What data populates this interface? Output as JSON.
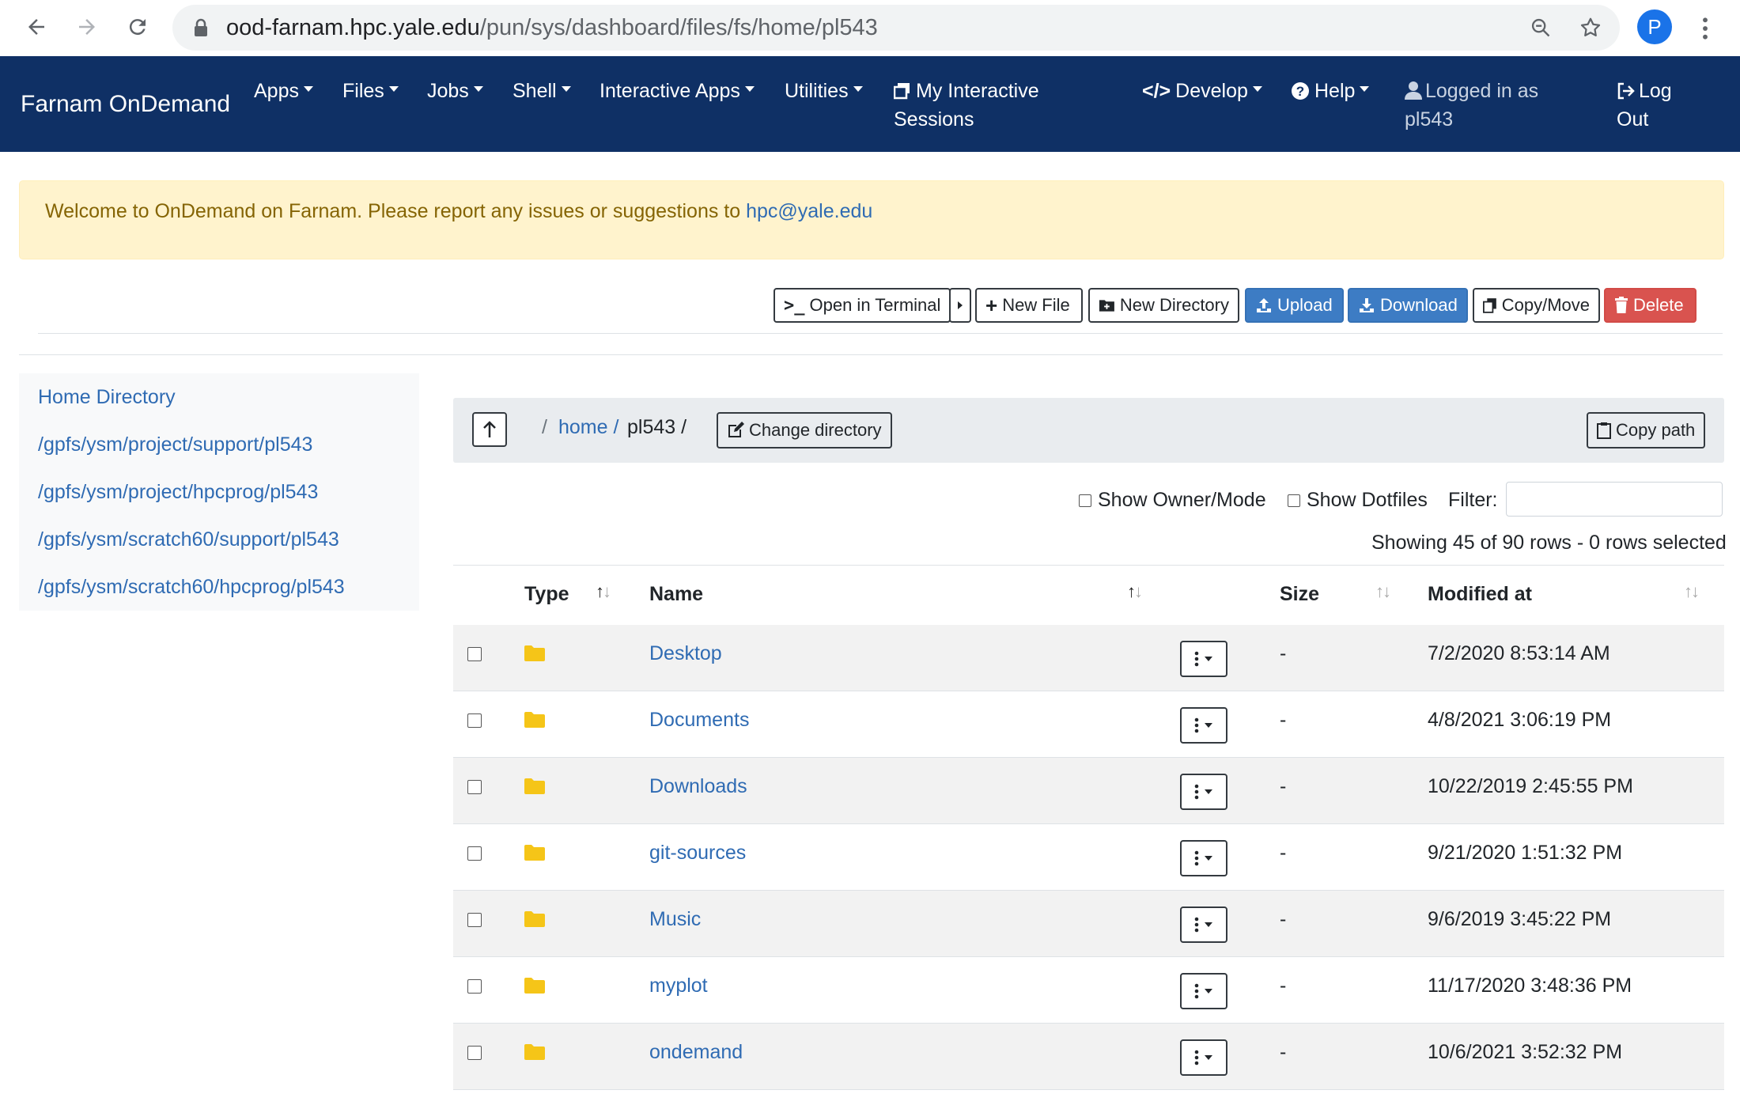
{
  "browser": {
    "url_host": "ood-farnam.hpc.yale.edu",
    "url_path": "/pun/sys/dashboard/files/fs/home/pl543",
    "profile_initial": "P"
  },
  "navbar": {
    "brand": "Farnam OnDemand",
    "items": {
      "apps": "Apps",
      "files": "Files",
      "jobs": "Jobs",
      "shell": "Shell",
      "interactive_apps": "Interactive Apps",
      "utilities": "Utilities",
      "sessions_line1": "My Interactive",
      "sessions_line2": "Sessions",
      "develop": "Develop",
      "help": "Help",
      "logged_in_line1": "Logged in as",
      "logged_in_line2": "pl543",
      "logout_line1": "Log",
      "logout_line2": "Out"
    }
  },
  "alert": {
    "text": "Welcome to OnDemand on Farnam. Please report any issues or suggestions to ",
    "email": "hpc@yale.edu"
  },
  "toolbar": {
    "open_terminal": "Open in Terminal",
    "new_file": "New File",
    "new_directory": "New Directory",
    "upload": "Upload",
    "download": "Download",
    "copy_move": "Copy/Move",
    "delete": "Delete"
  },
  "favorites": [
    "Home Directory",
    "/gpfs/ysm/project/support/pl543",
    "/gpfs/ysm/project/hpcprog/pl543",
    "/gpfs/ysm/scratch60/support/pl543",
    "/gpfs/ysm/scratch60/hpcprog/pl543"
  ],
  "pathbar": {
    "crumb_root": "/",
    "crumb_home": "home /",
    "crumb_current": "pl543 /",
    "change_directory": "Change directory",
    "copy_path": "Copy path"
  },
  "options": {
    "show_owner_mode": "Show Owner/Mode",
    "show_dotfiles": "Show Dotfiles",
    "filter_label": "Filter:",
    "showing": "Showing 45 of 90 rows - 0 rows selected"
  },
  "table": {
    "columns": {
      "type": "Type",
      "name": "Name",
      "size": "Size",
      "modified": "Modified at"
    },
    "rows": [
      {
        "name": "Desktop",
        "size": "-",
        "modified": "7/2/2020 8:53:14 AM"
      },
      {
        "name": "Documents",
        "size": "-",
        "modified": "4/8/2021 3:06:19 PM"
      },
      {
        "name": "Downloads",
        "size": "-",
        "modified": "10/22/2019 2:45:55 PM"
      },
      {
        "name": "git-sources",
        "size": "-",
        "modified": "9/21/2020 1:51:32 PM"
      },
      {
        "name": "Music",
        "size": "-",
        "modified": "9/6/2019 3:45:22 PM"
      },
      {
        "name": "myplot",
        "size": "-",
        "modified": "11/17/2020 3:48:36 PM"
      },
      {
        "name": "ondemand",
        "size": "-",
        "modified": "10/6/2021 3:52:32 PM"
      }
    ]
  },
  "colors": {
    "navbar": "#0f3065",
    "link": "#2f6bb3",
    "alert_bg": "#fff3cd",
    "primary_btn": "#3d7cc4",
    "danger_btn": "#d9534f",
    "folder": "#f5c518"
  }
}
